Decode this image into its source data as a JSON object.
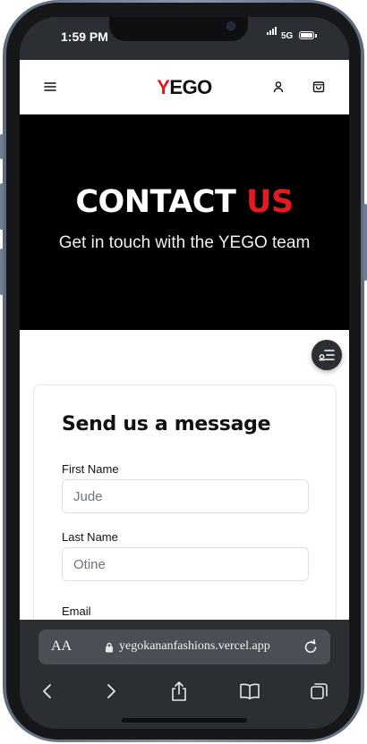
{
  "status_bar": {
    "time": "1:59 PM",
    "network": "5G"
  },
  "header": {
    "menu_icon": "hamburger-menu-icon",
    "logo_first": "Y",
    "logo_rest": "EGO",
    "account_icon": "user-icon",
    "cart_icon": "shopping-bag-icon"
  },
  "hero": {
    "title_main": "CONTACT",
    "title_accent": "US",
    "subtitle": "Get in touch with the YEGO team"
  },
  "floating_button": {
    "icon": "filter-list-icon"
  },
  "form": {
    "heading": "Send us a message",
    "first_name": {
      "label": "First Name",
      "placeholder": "Jude"
    },
    "last_name": {
      "label": "Last Name",
      "placeholder": "Otine"
    },
    "email": {
      "label": "Email"
    }
  },
  "browser": {
    "text_size_label": "AA",
    "url": "yegokananfashions.vercel.app",
    "toolbar_icons": [
      "back-icon",
      "forward-icon",
      "share-icon",
      "bookmarks-icon",
      "tabs-icon"
    ]
  },
  "colors": {
    "accent_red": "#e01b24",
    "hero_bg": "#000000",
    "browser_bg": "#2b2f33"
  }
}
